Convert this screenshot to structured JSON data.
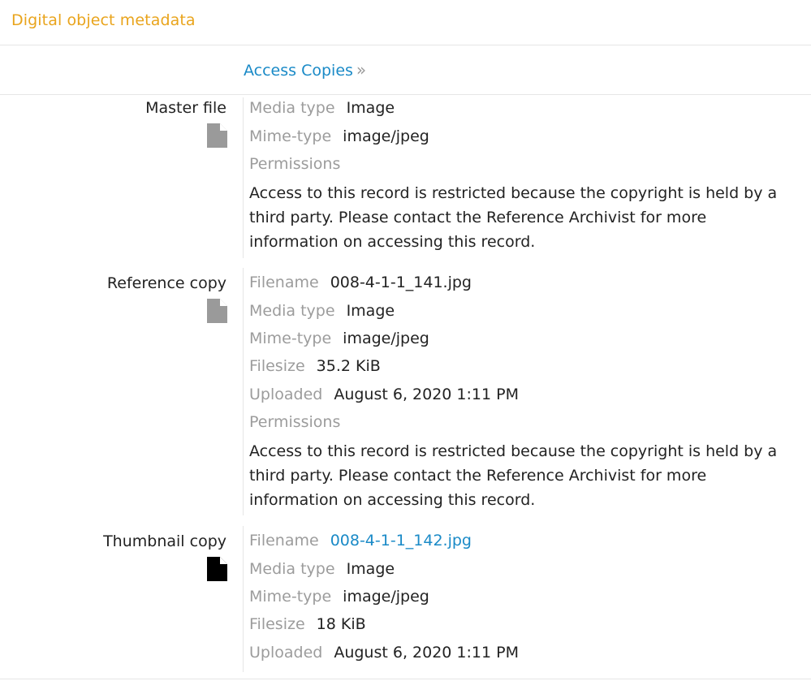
{
  "section": {
    "title": "Digital object metadata"
  },
  "access_copies": {
    "label": "Access Copies",
    "chevron": "»"
  },
  "master_file": {
    "label": "Master file",
    "icon": "file-icon-gray",
    "media_type_label": "Media type",
    "media_type": "Image",
    "mime_label": "Mime-type",
    "mime": "image/jpeg",
    "permissions_label": "Permissions",
    "permissions_text": "Access to this record is restricted because the copyright is held by a third party. Please contact the Reference Archivist for more information on accessing this record."
  },
  "reference_copy": {
    "label": "Reference copy",
    "icon": "file-icon-gray",
    "filename_label": "Filename",
    "filename": "008-4-1-1_141.jpg",
    "media_type_label": "Media type",
    "media_type": "Image",
    "mime_label": "Mime-type",
    "mime": "image/jpeg",
    "filesize_label": "Filesize",
    "filesize": "35.2 KiB",
    "uploaded_label": "Uploaded",
    "uploaded": "August 6, 2020 1:11 PM",
    "permissions_label": "Permissions",
    "permissions_text": "Access to this record is restricted because the copyright is held by a third party. Please contact the Reference Archivist for more information on accessing this record."
  },
  "thumbnail_copy": {
    "label": "Thumbnail copy",
    "icon": "file-icon-black",
    "filename_label": "Filename",
    "filename": "008-4-1-1_142.jpg",
    "media_type_label": "Media type",
    "media_type": "Image",
    "mime_label": "Mime-type",
    "mime": "image/jpeg",
    "filesize_label": "Filesize",
    "filesize": "18 KiB",
    "uploaded_label": "Uploaded",
    "uploaded": "August 6, 2020 1:11 PM"
  },
  "colors": {
    "accent_title": "#e9a41c",
    "link": "#1a8ac7",
    "label_gray": "#9c9c9c",
    "icon_gray": "#9a9a9a",
    "icon_black": "#000000"
  }
}
